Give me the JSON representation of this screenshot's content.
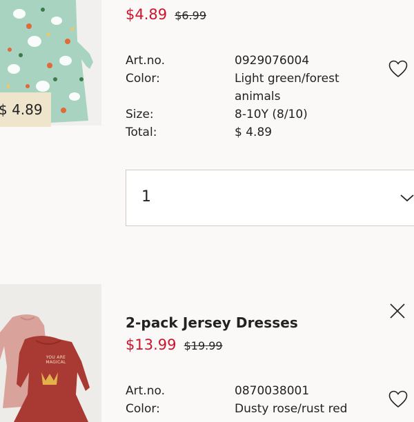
{
  "items": [
    {
      "price_sale": "$4.89",
      "price_old": "$6.99",
      "overlay_price": "$ 4.89",
      "details": [
        {
          "label": "Art.no.",
          "value": "0929076004"
        },
        {
          "label": "Color:",
          "value": "Light green/forest animals"
        },
        {
          "label": "Size:",
          "value": "8-10Y (8/10)"
        },
        {
          "label": "Total:",
          "value": "$ 4.89"
        }
      ],
      "quantity": "1",
      "icons": {
        "favorite": "heart-icon",
        "dropdown": "chevron-down-icon"
      }
    },
    {
      "name": "2-pack Jersey Dresses",
      "price_sale": "$13.99",
      "price_old": "$19.99",
      "print_text": "YOU ARE MAGICAL",
      "details": [
        {
          "label": "Art.no.",
          "value": "0870038001"
        },
        {
          "label": "Color:",
          "value": "Dusty rose/rust red"
        }
      ],
      "icons": {
        "remove": "close-icon",
        "favorite": "heart-icon"
      }
    }
  ],
  "colors": {
    "sale_price": "#d0122a",
    "background": "#faf9f8",
    "price_tag_bg": "#efe4cc"
  }
}
